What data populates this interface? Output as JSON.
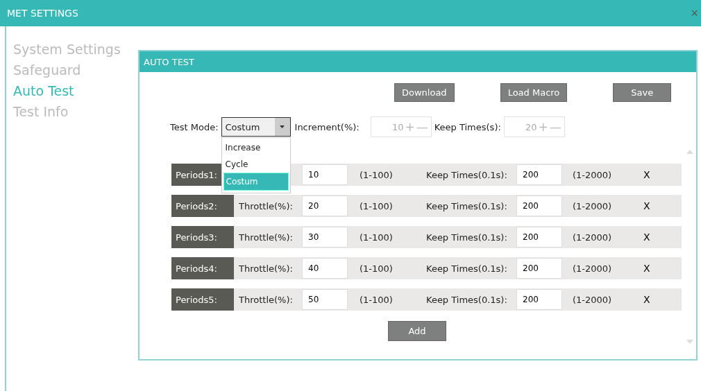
{
  "window": {
    "title": "MET SETTINGS",
    "close": "×"
  },
  "sidebar": {
    "items": [
      {
        "label": "System Settings",
        "selected": false
      },
      {
        "label": "Safeguard",
        "selected": false
      },
      {
        "label": "Auto Test",
        "selected": true
      },
      {
        "label": "Test Info",
        "selected": false
      }
    ]
  },
  "panel": {
    "title": "AUTO TEST",
    "buttons": [
      "Download",
      "Load Macro",
      "Save"
    ],
    "test_mode": {
      "label": "Test Mode:",
      "value": "Costum",
      "expanded": true,
      "options": [
        {
          "label": "Increase",
          "selected": false
        },
        {
          "label": "Cycle",
          "selected": false
        },
        {
          "label": "Costum",
          "selected": true
        }
      ]
    },
    "increment": {
      "label": "Increment(%):",
      "value": "10",
      "plus": "+",
      "minus": "—"
    },
    "keep_times": {
      "label": "Keep Times(s):",
      "value": "20",
      "plus": "+",
      "minus": "—"
    },
    "periods": [
      {
        "label": "Periods1:",
        "throttle_value": "10",
        "throttle_range": "(1-100)",
        "keep_label": "Keep Times(0.1s):",
        "keep_value": "200",
        "keep_range": "(1-2000)",
        "remove": "X"
      },
      {
        "label": "Periods2:",
        "throttle_label": "Throttle(%):",
        "throttle_value": "20",
        "throttle_range": "(1-100)",
        "keep_label": "Keep Times(0.1s):",
        "keep_value": "200",
        "keep_range": "(1-2000)",
        "remove": "X"
      },
      {
        "label": "Periods3:",
        "throttle_label": "Throttle(%):",
        "throttle_value": "30",
        "throttle_range": "(1-100)",
        "keep_label": "Keep Times(0.1s):",
        "keep_value": "200",
        "keep_range": "(1-2000)",
        "remove": "X"
      },
      {
        "label": "Periods4:",
        "throttle_label": "Throttle(%):",
        "throttle_value": "40",
        "throttle_range": "(1-100)",
        "keep_label": "Keep Times(0.1s):",
        "keep_value": "200",
        "keep_range": "(1-2000)",
        "remove": "X"
      },
      {
        "label": "Periods5:",
        "throttle_label": "Throttle(%):",
        "throttle_value": "50",
        "throttle_range": "(1-100)",
        "keep_label": "Keep Times(0.1s):",
        "keep_value": "200",
        "keep_range": "(1-2000)",
        "remove": "X"
      }
    ],
    "add_button": "Add"
  }
}
